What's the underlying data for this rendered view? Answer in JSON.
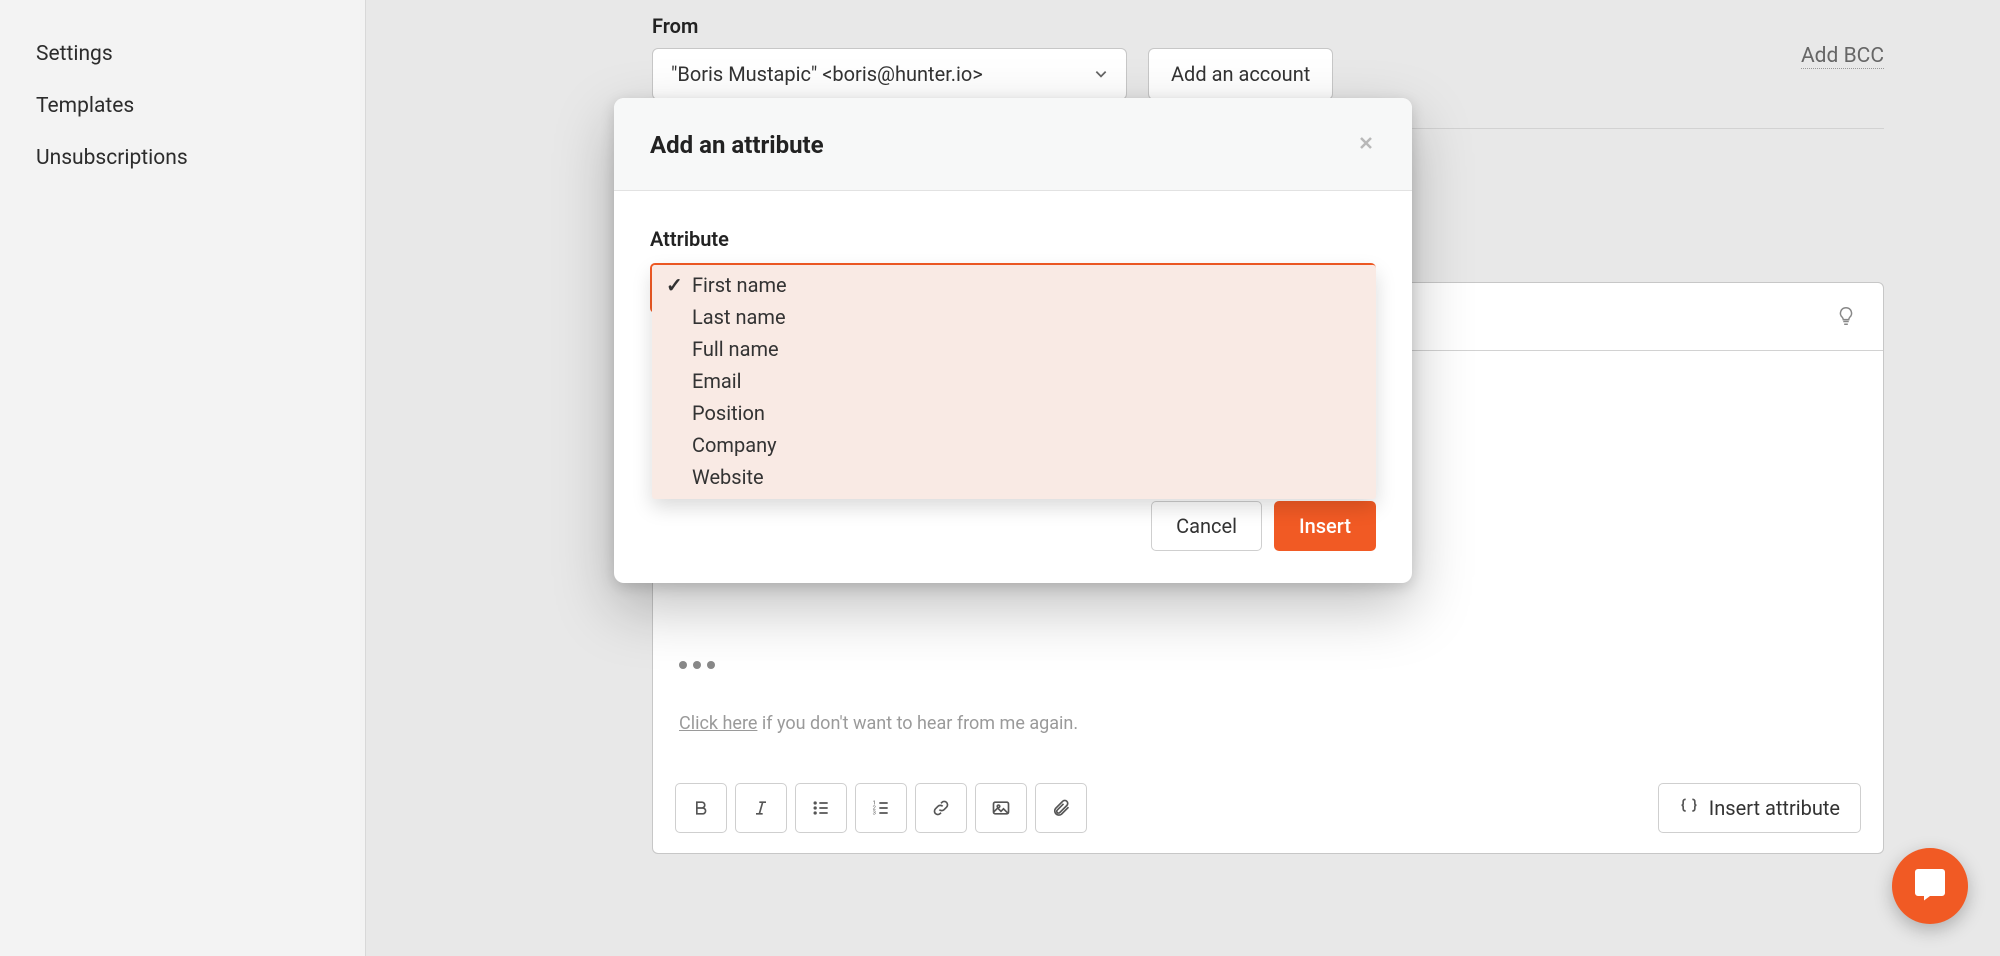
{
  "sidebar": {
    "items": [
      {
        "label": "Settings"
      },
      {
        "label": "Templates"
      },
      {
        "label": "Unsubscriptions"
      }
    ]
  },
  "form": {
    "from_label": "From",
    "from_value": "\"Boris Mustapic\" <boris@hunter.io>",
    "add_account": "Add an account",
    "add_bcc": "Add BCC"
  },
  "editor": {
    "unsub_link": "Click here",
    "unsub_text": " if you don't want to hear from me again.",
    "insert_attribute": "Insert attribute"
  },
  "modal": {
    "title": "Add an attribute",
    "attr_label": "Attribute",
    "options": [
      "First name",
      "Last name",
      "Full name",
      "Email",
      "Position",
      "Company",
      "Website"
    ],
    "selected_index": 0,
    "cancel": "Cancel",
    "insert": "Insert"
  }
}
